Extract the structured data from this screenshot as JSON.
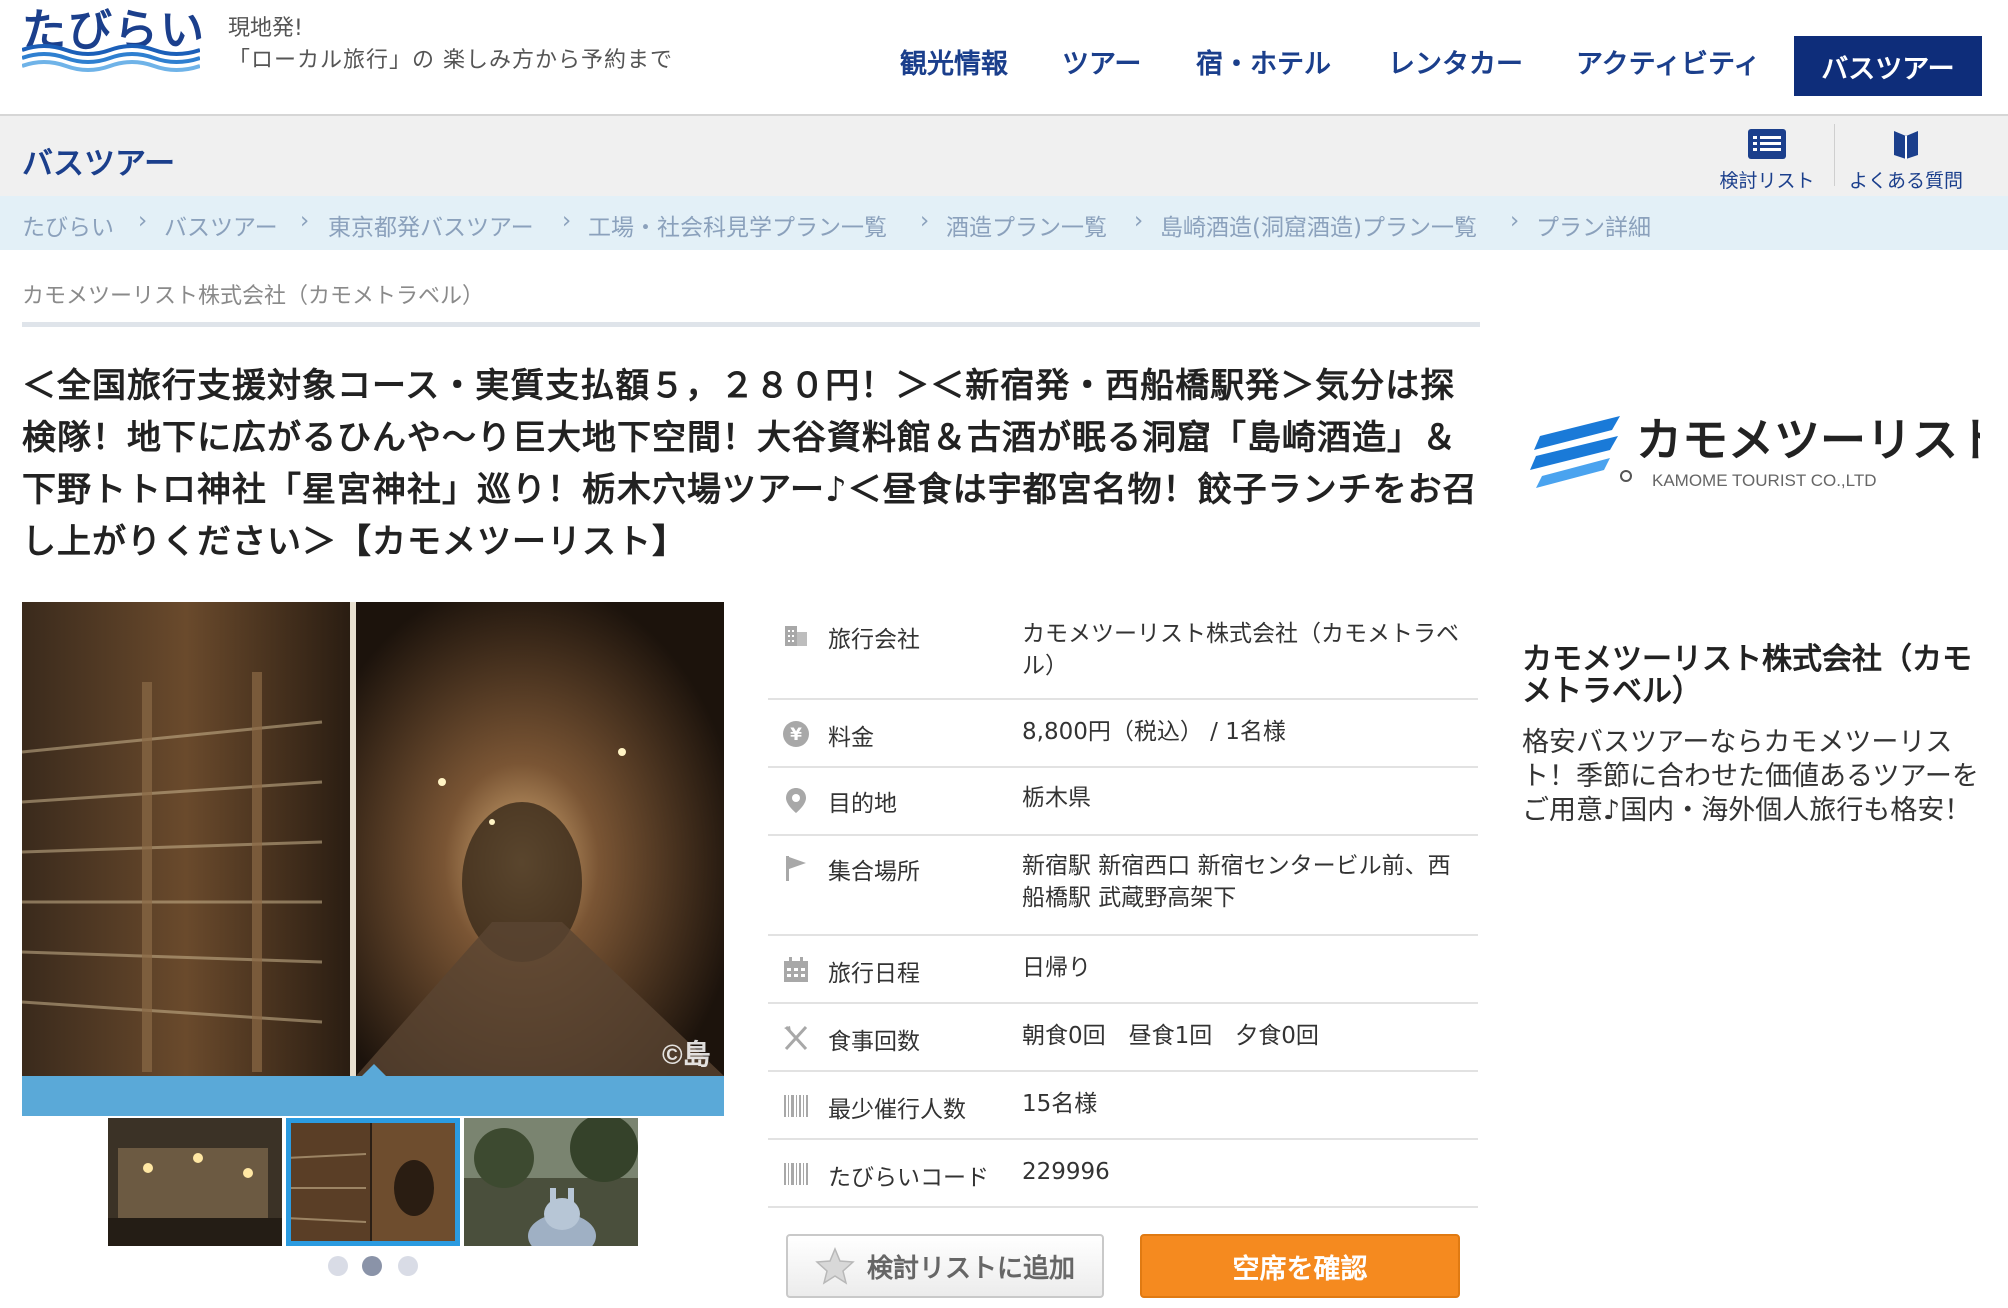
{
  "header": {
    "logo_text": "たびらい",
    "tagline_line1": "現地発!",
    "tagline_line2": "「ローカル旅行」の 楽しみ方から予約まで",
    "nav": [
      "観光情報",
      "ツアー",
      "宿・ホテル",
      "レンタカー",
      "アクティビティ"
    ],
    "nav_active": "バスツアー"
  },
  "subheader": {
    "title": "バスツアー",
    "util_list_label": "検討リスト",
    "util_faq_label": "よくある質問"
  },
  "breadcrumb": [
    "たびらい",
    "バスツアー",
    "東京都発バスツアー",
    "工場・社会科見学プラン一覧",
    "酒造プラン一覧",
    "島崎酒造(洞窟酒造)プラン一覧",
    "プラン詳細"
  ],
  "company_small": "カモメツーリスト株式会社（カモメトラベル）",
  "title": "＜全国旅行支援対象コース・実質支払額５，２８０円！＞＜新宿発・西船橋駅発＞気分は探検隊！地下に広がるひんや～り巨大地下空間！大谷資料館＆古酒が眠る洞窟「島崎酒造」＆下野トトロ神社「星宮神社」巡り！栃木穴場ツアー♪＜昼食は宇都宮名物！餃子ランチをお召し上がりください＞【カモメツーリスト】",
  "gallery": {
    "watermark": "©島",
    "thumb_count": 3,
    "selected_index": 1
  },
  "details": [
    {
      "icon": "building-icon",
      "label": "旅行会社",
      "value": "カモメツーリスト株式会社（カモメトラベル）"
    },
    {
      "icon": "yen-icon",
      "label": "料金",
      "value": "8,800円（税込） / 1名様"
    },
    {
      "icon": "map-pin-icon",
      "label": "目的地",
      "value": "栃木県"
    },
    {
      "icon": "flag-icon",
      "label": "集合場所",
      "value": "新宿駅 新宿西口 新宿センタービル前、西船橋駅 武蔵野高架下"
    },
    {
      "icon": "calendar-icon",
      "label": "旅行日程",
      "value": "日帰り"
    },
    {
      "icon": "fork-knife-icon",
      "label": "食事回数",
      "value": "朝食0回　昼食1回　夕食0回"
    },
    {
      "icon": "barcode-icon",
      "label": "最少催行人数",
      "value": "15名様"
    },
    {
      "icon": "barcode-icon",
      "label": "たびらいコード",
      "value": "229996"
    }
  ],
  "buttons": {
    "add_to_list": "検討リストに追加",
    "check_availability": "空席を確認"
  },
  "brand": {
    "logo_text": "カモメツーリスト",
    "logo_subtext": "KAMOME TOURIST CO.,LTD",
    "name": "カモメツーリスト株式会社（カモメトラベル）",
    "description": "格安バスツアーならカモメツーリスト！季節に合わせた価値あるツアーをご用意♪国内・海外個人旅行も格安！"
  },
  "colors": {
    "brand_navy": "#1b3f8c",
    "nav_active_bg": "#0e2d7a",
    "cta_orange": "#f58a1f",
    "breadcrumb_bg": "#e3f0f7"
  }
}
